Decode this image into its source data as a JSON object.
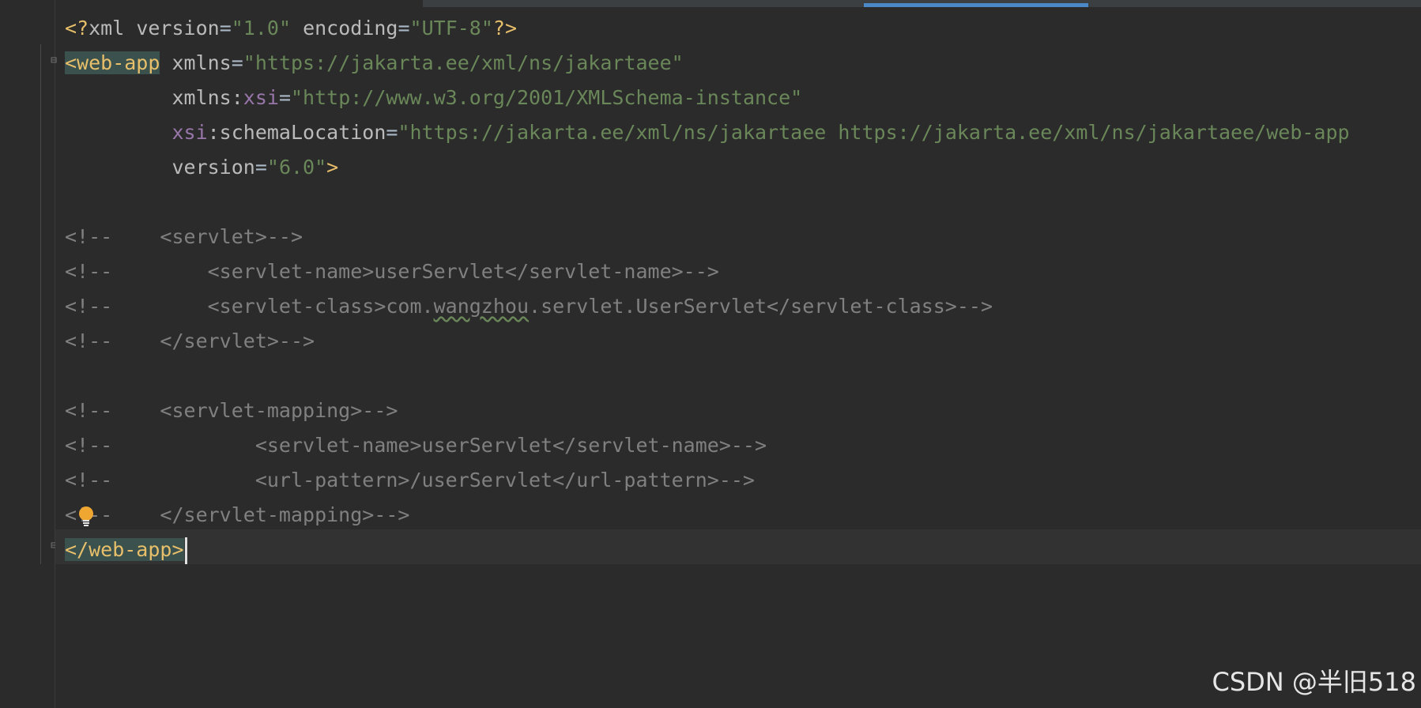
{
  "editor": {
    "lines": [
      "<?xml version=\"1.0\" encoding=\"UTF-8\"?>",
      "<web-app xmlns=\"https://jakarta.ee/xml/ns/jakartaee\"",
      "         xmlns:xsi=\"http://www.w3.org/2001/XMLSchema-instance\"",
      "         xsi:schemaLocation=\"https://jakarta.ee/xml/ns/jakartaee https://jakarta.ee/xml/ns/jakartaee/web-app",
      "         version=\"6.0\">",
      "",
      "<!--    <servlet>-->",
      "<!--        <servlet-name>userServlet</servlet-name>-->",
      "<!--        <servlet-class>com.wangzhou.servlet.UserServlet</servlet-class>-->",
      "<!--    </servlet>-->",
      "",
      "<!--    <servlet-mapping>-->",
      "<!--            <servlet-name>userServlet</servlet-name>-->",
      "<!--            <url-pattern>/userServlet</url-pattern>-->",
      "<!--    </servlet-mapping>-->",
      "</web-app>"
    ],
    "syntax_colors": {
      "background": "#2b2b2b",
      "tag": "#e8bf6a",
      "attribute": "#bababa",
      "namespace": "#9876aa",
      "string": "#6a8759",
      "comment": "#808080",
      "tag_highlight": "#3b514d"
    },
    "active_tab_accent": "#4a88c7"
  },
  "icons": {
    "fold_open": "fold-open-icon",
    "fold_close": "fold-close-icon",
    "intention": "lightbulb-icon"
  },
  "watermark": {
    "text": "CSDN @半旧518"
  }
}
